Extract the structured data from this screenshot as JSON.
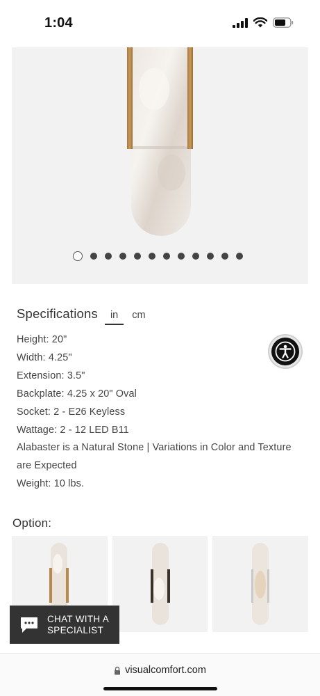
{
  "status_bar": {
    "time": "1:04",
    "icons": [
      "cellular-signal-icon",
      "wifi-icon",
      "battery-icon"
    ]
  },
  "gallery": {
    "image": "alabaster-wall-sconce",
    "dot_count": 12,
    "active_index": 0
  },
  "specifications": {
    "title": "Specifications",
    "units": [
      {
        "label": "in",
        "active": true
      },
      {
        "label": "cm",
        "active": false
      }
    ],
    "lines": [
      "Height: 20\"",
      "Width: 4.25\"",
      "Extension: 3.5\"",
      "Backplate: 4.25 x 20\" Oval",
      "Socket: 2 - E26 Keyless",
      "Wattage: 2 - 12 LED B11",
      "Alabaster is a Natural Stone | Variations in Color and Texture",
      "are Expected",
      "Weight: 10 lbs."
    ]
  },
  "accessibility": {
    "icon": "accessibility-icon"
  },
  "options": {
    "title": "Option:",
    "items": [
      {
        "finish": "antique-brass",
        "accent": "#b58a4c"
      },
      {
        "finish": "bronze",
        "accent": "#3a3228"
      },
      {
        "finish": "polished-nickel",
        "accent": "#c9c9c9"
      }
    ]
  },
  "chat": {
    "label_line1": "CHAT WITH A",
    "label_line2": "SPECIALIST",
    "icon": "chat-bubble-icon"
  },
  "browser": {
    "url": "visualcomfort.com",
    "icon": "lock-icon"
  }
}
